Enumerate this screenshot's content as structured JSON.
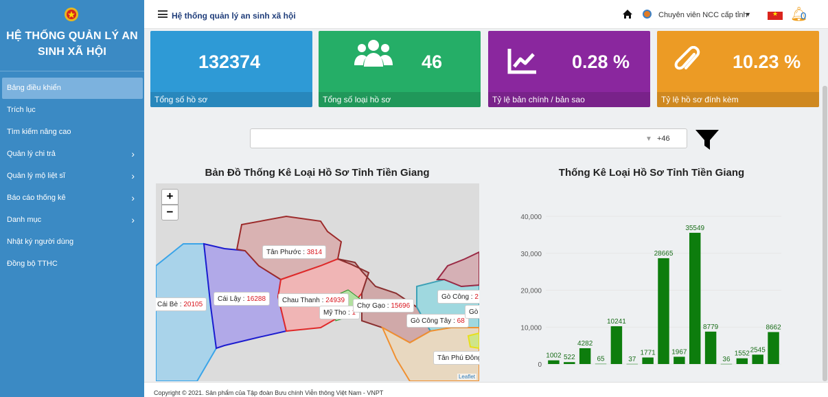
{
  "sidebar": {
    "title": "HỆ THỐNG QUẢN LÝ AN SINH XÃ HỘI",
    "items": [
      {
        "label": "Bảng điều khiển",
        "active": true,
        "chevron": false
      },
      {
        "label": "Trích lục",
        "active": false,
        "chevron": false
      },
      {
        "label": "Tìm kiếm nâng cao",
        "active": false,
        "chevron": false
      },
      {
        "label": "Quản lý chi trả",
        "active": false,
        "chevron": true
      },
      {
        "label": "Quản lý mộ liệt sĩ",
        "active": false,
        "chevron": true
      },
      {
        "label": "Báo cáo thống kê",
        "active": false,
        "chevron": true
      },
      {
        "label": "Danh mục",
        "active": false,
        "chevron": true
      },
      {
        "label": "Nhật ký người dùng",
        "active": false,
        "chevron": false
      },
      {
        "label": "Đồng bộ TTHC",
        "active": false,
        "chevron": false
      }
    ]
  },
  "topbar": {
    "title": "Hệ thống quản lý an sinh xã hội",
    "user": "Chuyên viên NCC cấp tỉnh",
    "notifications": "0"
  },
  "cards": [
    {
      "value": "132374",
      "label": "Tổng số hồ sơ",
      "color": "#2e9ad6"
    },
    {
      "value": "46",
      "label": "Tổng số loại hồ sơ",
      "color": "#25ae67",
      "icon": "users-icon"
    },
    {
      "value": "0.28 %",
      "label": "Tỷ lệ bản chính / bản sao",
      "color": "#8a279e",
      "icon": "line-chart-icon"
    },
    {
      "value": "10.23 %",
      "label": "Tỷ lệ hồ sơ đính kèm",
      "color": "#ec9b25",
      "icon": "paperclip-icon"
    }
  ],
  "filter": {
    "count": "+46"
  },
  "map": {
    "title": "Bản Đồ Thống Kê Loại Hồ Sơ Tỉnh Tiền Giang",
    "attribution": "Leaflet",
    "labels": [
      {
        "name": "Tân Phước",
        "value": "3814"
      },
      {
        "name": "Cái Bè",
        "value": "20105"
      },
      {
        "name": "Cái Lậy",
        "value": "16288"
      },
      {
        "name": "Chau Thanh",
        "value": "24939"
      },
      {
        "name": "Mỹ Tho",
        "value": "1"
      },
      {
        "name": "Chợ Gạo",
        "value": "15696"
      },
      {
        "name": "Gò Công",
        "value": "2"
      },
      {
        "name": "Gò Công Tây",
        "value": "68"
      },
      {
        "name": "Gò",
        "value": ""
      },
      {
        "name": "Tân Phú Đông",
        "value": ""
      }
    ]
  },
  "chart_data": {
    "type": "bar",
    "title": "Thống Kê Loại Hồ Sơ Tỉnh Tiền Giang",
    "values": [
      1002,
      522,
      4282,
      65,
      10241,
      37,
      1771,
      28665,
      1967,
      35549,
      8779,
      36,
      1552,
      2545,
      8662
    ],
    "ylim": [
      0,
      40000
    ],
    "yticks": [
      "0",
      "10,000",
      "20,000",
      "30,000",
      "40,000"
    ],
    "color": "#0d7d0d",
    "grid": true
  },
  "footer": {
    "text": "Copyright © 2021. Sản phẩm của Tập đoàn Bưu chính Viễn thông Việt Nam - VNPT"
  }
}
